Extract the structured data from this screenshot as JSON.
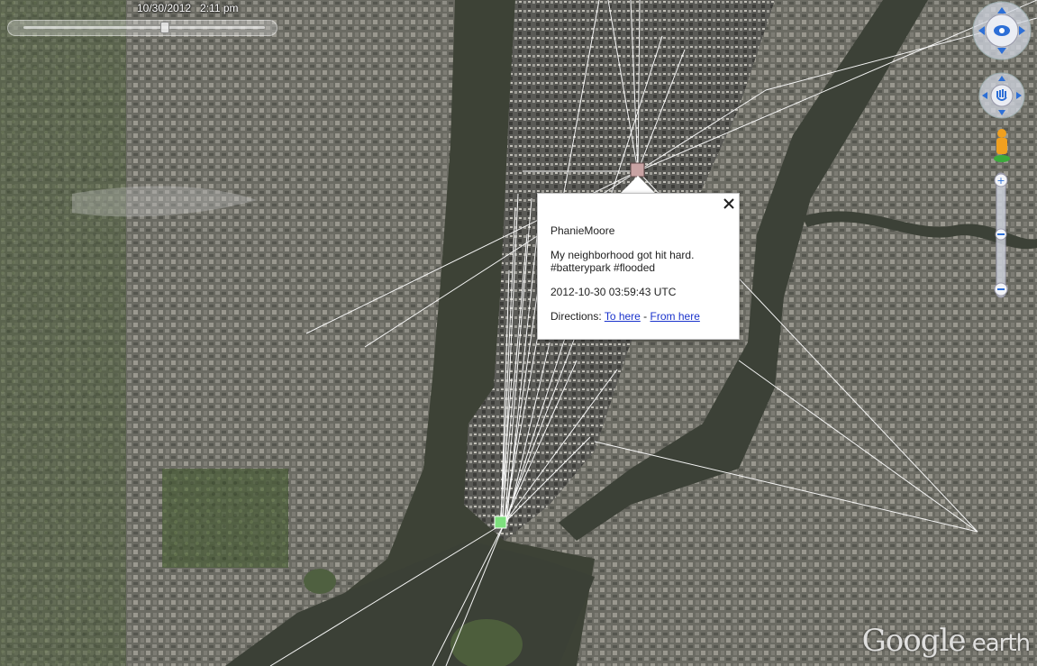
{
  "time_slider": {
    "label": "10/30/2012   2:11 pm"
  },
  "balloon": {
    "author": "PhanieMoore",
    "text_line1": "My neighborhood got hit hard.",
    "text_line2": "#batterypark #flooded",
    "timestamp": "2012-10-30 03:59:43 UTC",
    "directions_label": "Directions:",
    "to_here": "To here",
    "separator": " - ",
    "from_here": "From here"
  },
  "watermark": {
    "google": "Google",
    "earth": " earth"
  },
  "colors": {
    "link": "#1a33cc",
    "water": "#3a3f36",
    "marker_selected": "#7ee07e",
    "marker_other": "#c8a3a3"
  },
  "icons": {
    "close": "close-icon",
    "look": "look-joystick-icon",
    "move": "move-joystick-icon",
    "pegman": "pegman-icon",
    "zoom_in": "plus-icon",
    "zoom_out": "minus-icon"
  }
}
